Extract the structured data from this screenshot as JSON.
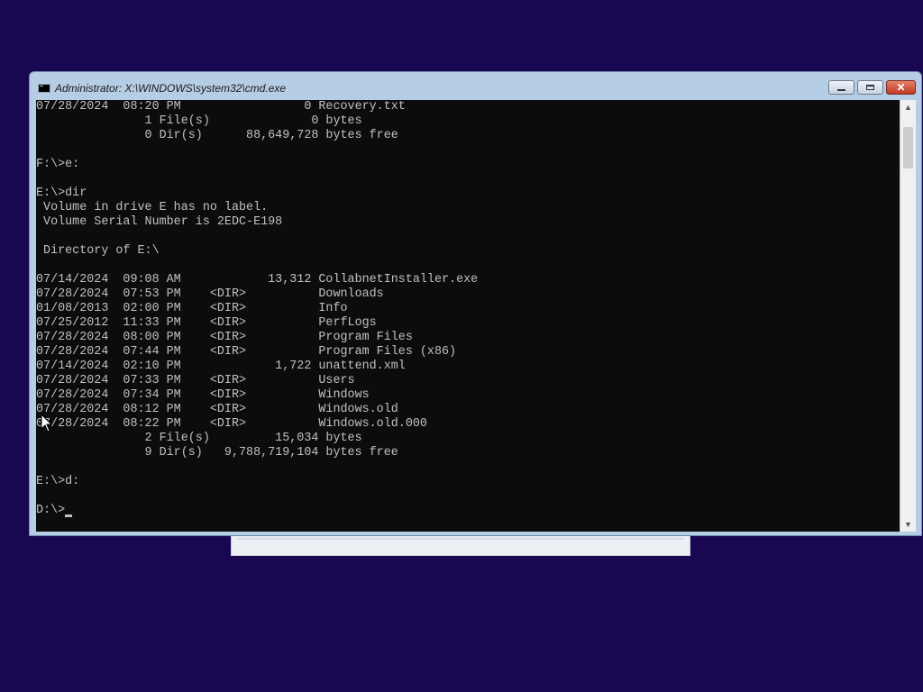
{
  "window": {
    "title": "Administrator: X:\\WINDOWS\\system32\\cmd.exe"
  },
  "console": {
    "lines": [
      "07/28/2024  08:20 PM                 0 Recovery.txt",
      "               1 File(s)              0 bytes",
      "               0 Dir(s)      88,649,728 bytes free",
      "",
      "F:\\>e:",
      "",
      "E:\\>dir",
      " Volume in drive E has no label.",
      " Volume Serial Number is 2EDC-E198",
      "",
      " Directory of E:\\",
      "",
      "07/14/2024  09:08 AM            13,312 CollabnetInstaller.exe",
      "07/28/2024  07:53 PM    <DIR>          Downloads",
      "01/08/2013  02:00 PM    <DIR>          Info",
      "07/25/2012  11:33 PM    <DIR>          PerfLogs",
      "07/28/2024  08:00 PM    <DIR>          Program Files",
      "07/28/2024  07:44 PM    <DIR>          Program Files (x86)",
      "07/14/2024  02:10 PM             1,722 unattend.xml",
      "07/28/2024  07:33 PM    <DIR>          Users",
      "07/28/2024  07:34 PM    <DIR>          Windows",
      "07/28/2024  08:12 PM    <DIR>          Windows.old",
      "07/28/2024  08:22 PM    <DIR>          Windows.old.000",
      "               2 File(s)         15,034 bytes",
      "               9 Dir(s)   9,788,719,104 bytes free",
      "",
      "E:\\>d:",
      ""
    ],
    "prompt": "D:\\>"
  },
  "icons": {
    "app": "console-icon",
    "minimize": "minimize-icon",
    "maximize": "maximize-icon",
    "close": "close-icon",
    "scroll_up": "scroll-up-arrow-icon",
    "scroll_down": "scroll-down-arrow-icon",
    "pointer": "mouse-pointer-icon"
  },
  "colors": {
    "desktop_background": "#1a0752",
    "console_background": "#0c0c0c",
    "console_text": "#c0c0c0",
    "window_frame": "#b6cde6",
    "close_button": "#c23a22"
  }
}
